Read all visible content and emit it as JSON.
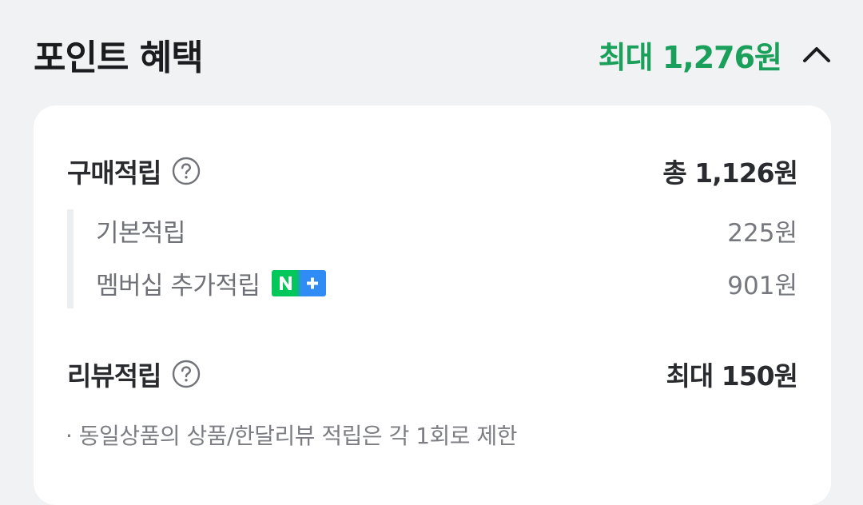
{
  "header": {
    "title": "포인트 혜택",
    "max_amount": "최대 1,276원",
    "toggle_icon": "chevron-up-icon"
  },
  "purchase": {
    "label": "구매적립",
    "help_icon": "question-circle-icon",
    "total": "총 1,126원",
    "items": [
      {
        "label": "기본적립",
        "value": "225원"
      },
      {
        "label": "멤버십 추가적립",
        "value": "901원",
        "badge_text": "N+"
      }
    ]
  },
  "review": {
    "label": "리뷰적립",
    "help_icon": "question-circle-icon",
    "value": "최대 150원",
    "note": "· 동일상품의 상품/한달리뷰 적립은 각 1회로 제한"
  },
  "colors": {
    "accent_green": "#1aa05a",
    "badge_green": "#03c75a",
    "badge_blue": "#2f8cf5",
    "background": "#f1f2f4",
    "card": "#ffffff"
  }
}
